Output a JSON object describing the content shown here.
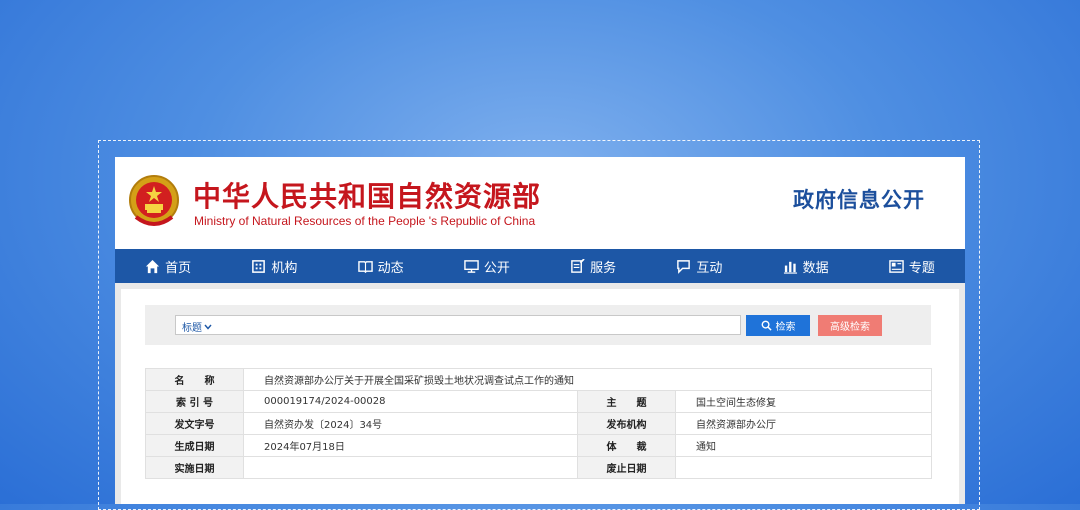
{
  "site": {
    "title": "中华人民共和国自然资源部",
    "subtitle": "Ministry of Natural Resources of the People 's Republic of China",
    "section": "政府信息公开"
  },
  "nav": {
    "items": [
      {
        "label": "首页",
        "icon": "home-icon"
      },
      {
        "label": "机构",
        "icon": "building-icon"
      },
      {
        "label": "动态",
        "icon": "book-icon"
      },
      {
        "label": "公开",
        "icon": "monitor-icon"
      },
      {
        "label": "服务",
        "icon": "document-edit-icon"
      },
      {
        "label": "互动",
        "icon": "chat-icon"
      },
      {
        "label": "数据",
        "icon": "bar-chart-icon"
      },
      {
        "label": "专题",
        "icon": "newspaper-icon"
      }
    ]
  },
  "search": {
    "scope": "标题",
    "placeholder": "",
    "search_label": "检索",
    "advanced_label": "高级检索"
  },
  "meta": {
    "name_label": "名　　称",
    "name_value": "自然资源部办公厅关于开展全国采矿损毁土地状况调查试点工作的通知",
    "index_label": "索 引 号",
    "index_value": "000019174/2024-00028",
    "subject_label": "主　　题",
    "subject_value": "国土空间生态修复",
    "doc_no_label": "发文字号",
    "doc_no_value": "自然资办发〔2024〕34号",
    "issuer_label": "发布机构",
    "issuer_value": "自然资源部办公厅",
    "created_label": "生成日期",
    "created_value": "2024年07月18日",
    "genre_label": "体　　裁",
    "genre_value": "通知",
    "effective_label": "实施日期",
    "effective_value": "",
    "expiry_label": "废止日期",
    "expiry_value": ""
  },
  "colors": {
    "brand_red": "#c5161d",
    "nav_blue": "#1d57a6",
    "search_blue": "#1f73d9",
    "advanced_red": "#f07c74"
  }
}
